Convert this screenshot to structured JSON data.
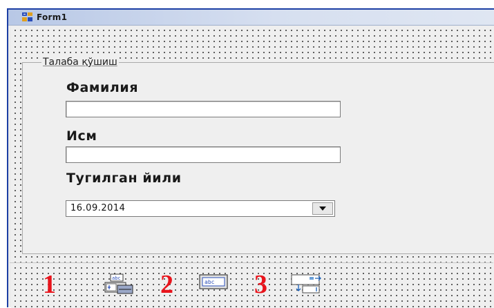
{
  "window": {
    "title": "Form1",
    "app_icon": "delphi-form-icon"
  },
  "groupbox": {
    "caption": "Талаба қўшиш",
    "fields": {
      "surname_label": "Фамилия",
      "name_label": "Исм",
      "birth_label": "Тугилган йили",
      "surname_value": "",
      "name_value": "",
      "birth_value": "16.09.2014"
    }
  },
  "components": [
    {
      "number": "1",
      "icon": "edit-component-icon"
    },
    {
      "number": "2",
      "icon": "label-component-icon"
    },
    {
      "number": "3",
      "icon": "datetimepicker-component-icon"
    }
  ],
  "colors": {
    "marker": "#e8141c",
    "titlebar": "#b8c8e6",
    "form_bg": "#efefef"
  }
}
